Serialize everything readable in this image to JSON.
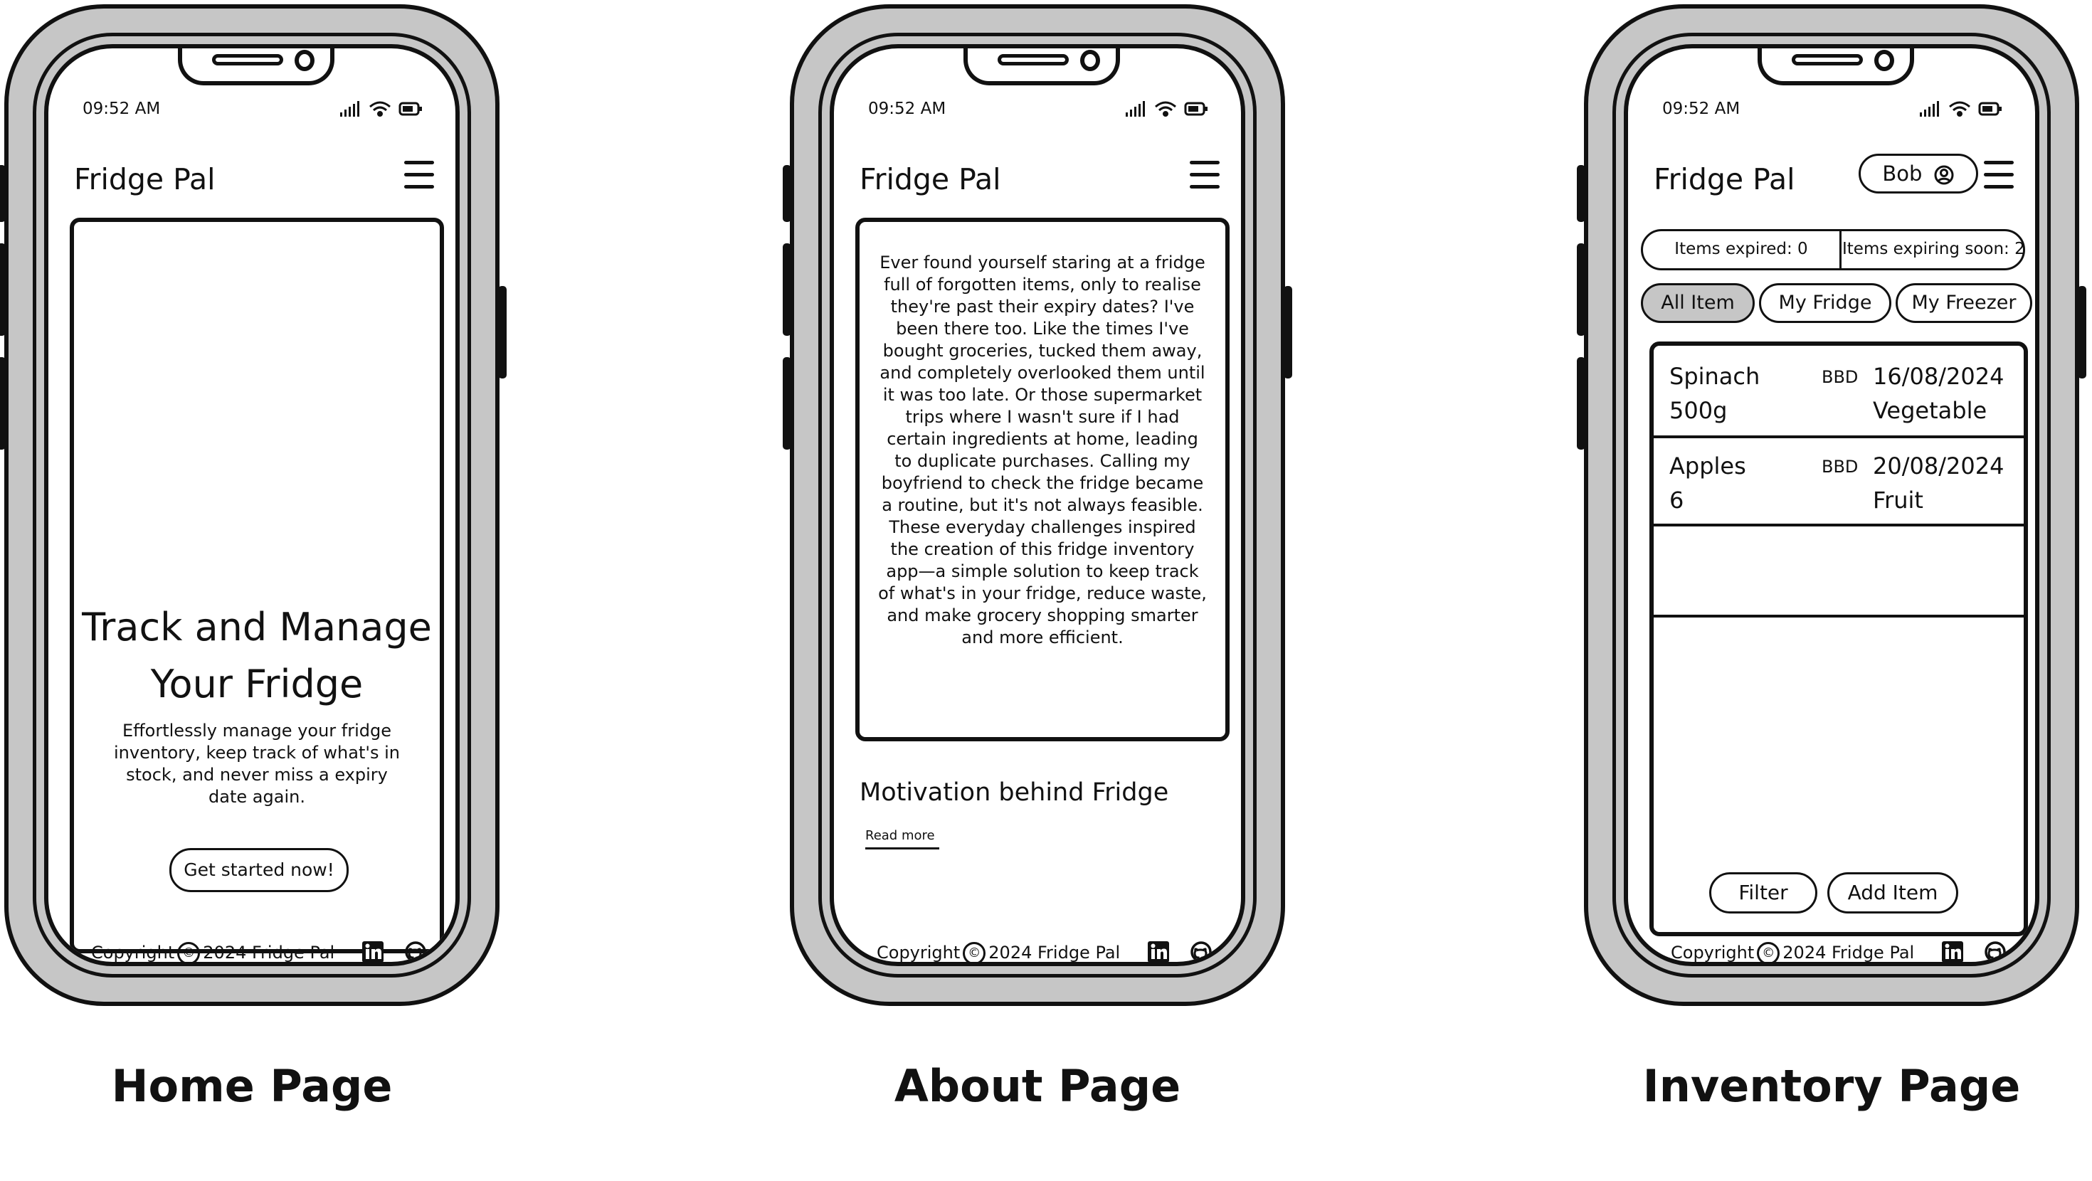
{
  "brand": {
    "app_name": "Fridge Pal"
  },
  "status_bar": {
    "time": "09:52 AM"
  },
  "footer": {
    "copyright_prefix": "Copyright",
    "copyright_symbol": "©",
    "copyright_text": "2024 Fridge Pal"
  },
  "colors": {
    "ink": "#111111",
    "phone_body": "#c6c6c6",
    "pill_active": "#c6c6c6",
    "background": "#ffffff"
  },
  "home": {
    "caption": "Home Page",
    "hero_title_line1": "Track and Manage",
    "hero_title_line2": "Your Fridge",
    "hero_subtitle": "Effortlessly manage your fridge inventory, keep track of what's in stock, and never miss a expiry date again.",
    "cta_label": "Get started now!"
  },
  "about": {
    "caption": "About Page",
    "story": "Ever found yourself staring at a fridge full of forgotten items, only to realise they're past their expiry dates? I've been there too. Like the times I've bought groceries, tucked them away, and completely overlooked them until it was too late. Or those supermarket trips where I wasn't sure if I had certain ingredients at home, leading to duplicate purchases. Calling my boyfriend to check the fridge became a routine, but it's not always feasible. These everyday challenges inspired the creation of this fridge inventory app—a simple solution to keep track of what's in your fridge, reduce waste, and make grocery shopping smarter and more efficient.",
    "section_title": "Motivation behind Fridge",
    "read_more": "Read more"
  },
  "inventory": {
    "caption": "Inventory Page",
    "user_name": "Bob",
    "stats": {
      "expired": "Items expired: 0",
      "expiring_soon": "Items expiring soon: 2"
    },
    "tabs": [
      {
        "label": "All Item",
        "active": true
      },
      {
        "label": "My Fridge",
        "active": false
      },
      {
        "label": "My Freezer",
        "active": false
      }
    ],
    "items": [
      {
        "name": "Spinach",
        "quantity": "500g",
        "bbd_label": "BBD",
        "date": "16/08/2024",
        "category": "Vegetable"
      },
      {
        "name": "Apples",
        "quantity": "6",
        "bbd_label": "BBD",
        "date": "20/08/2024",
        "category": "Fruit"
      }
    ],
    "filter_label": "Filter",
    "add_label": "Add Item"
  },
  "icons": [
    "signal-icon",
    "wifi-icon",
    "battery-icon",
    "menu-icon",
    "linkedin-icon",
    "github-icon",
    "user-icon",
    "copyright-icon"
  ]
}
